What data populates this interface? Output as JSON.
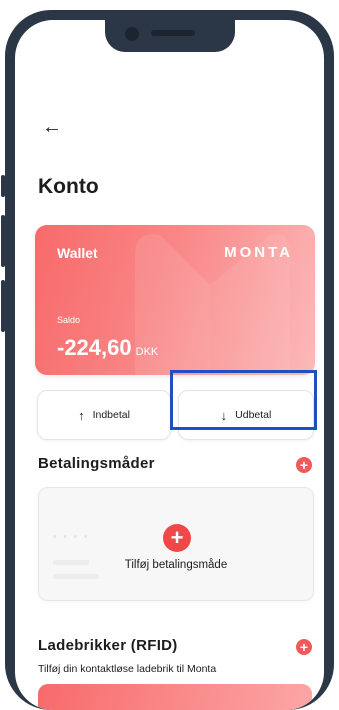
{
  "header": {
    "back_glyph": "←",
    "title": "Konto"
  },
  "wallet": {
    "label": "Wallet",
    "brand": "MONTA",
    "balance_label": "Saldo",
    "amount": "-224,60",
    "currency": "DKK"
  },
  "actions": {
    "deposit_icon": "↑",
    "deposit_label": "Indbetal",
    "withdraw_icon": "↓",
    "withdraw_label": "Udbetal"
  },
  "payment": {
    "title": "Betalingsmåder",
    "add_label": "Tilføj betalingsmåde"
  },
  "rfid": {
    "title": "Ladebrikker (RFID)",
    "description": "Tilføj din kontaktløse ladebrik til Monta"
  },
  "colors": {
    "accent": "#f05a5a",
    "highlight": "#1f4fc0",
    "device_frame": "#2b3646"
  },
  "icons": [
    "back-arrow-icon",
    "arrow-up-icon",
    "arrow-down-icon",
    "plus-icon"
  ]
}
